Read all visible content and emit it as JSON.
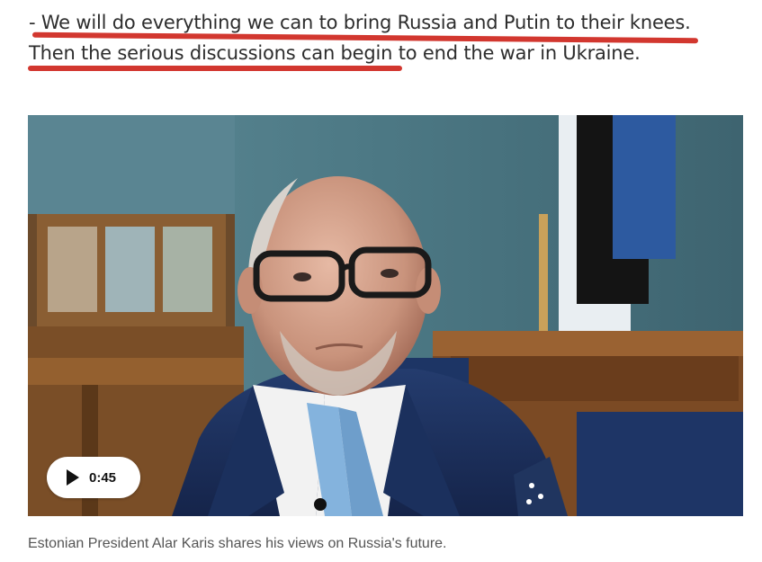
{
  "article": {
    "quote_line_1": "- We will do everything we can to bring Russia and Putin to their knees.",
    "quote_line_2": "Then the serious discussions can begin to end the war in Ukraine.",
    "highlight_color": "#d2372f"
  },
  "video": {
    "duration": "0:45",
    "play_icon": "play-icon"
  },
  "caption": "Estonian President Alar Karis shares his views on Russia's future."
}
